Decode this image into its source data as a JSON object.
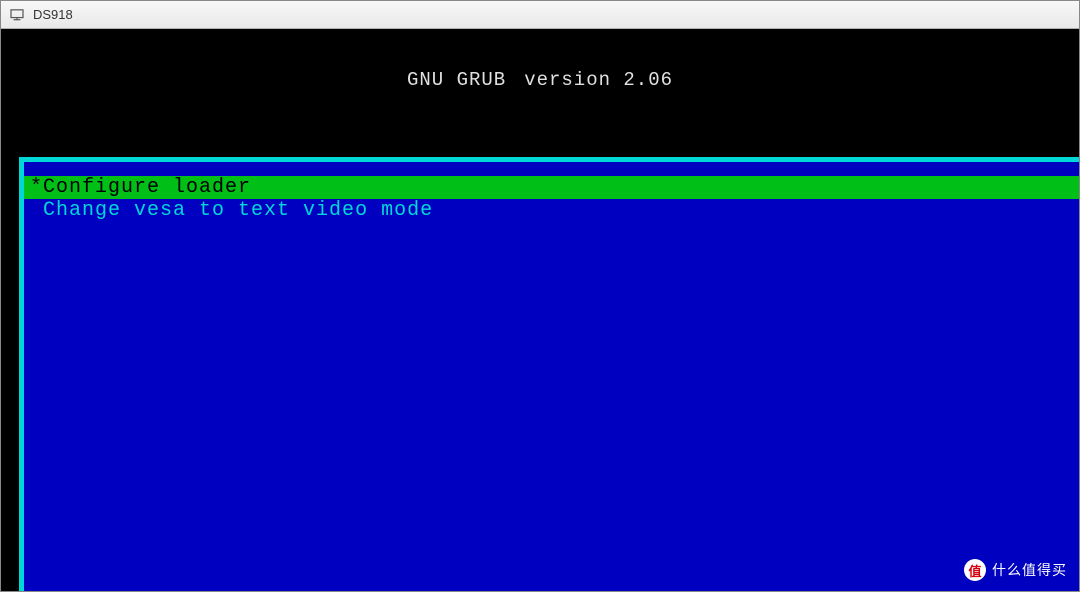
{
  "window": {
    "title": "DS918"
  },
  "grub": {
    "name": "GNU GRUB",
    "version": "version 2.06",
    "menu": {
      "selected_index": 0,
      "items": [
        "Configure loader",
        "Change vesa to text video mode"
      ]
    }
  },
  "watermark": {
    "badge": "值",
    "text": "什么值得买"
  }
}
